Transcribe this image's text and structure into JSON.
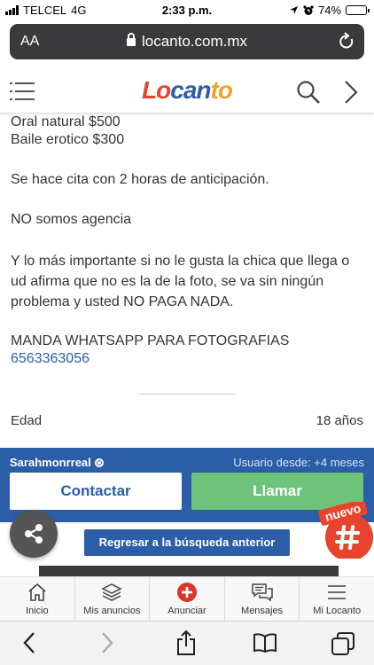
{
  "status_bar": {
    "carrier": "TELCEL",
    "network": "4G",
    "time": "2:33 p.m.",
    "battery": "74%",
    "battery_level": 0.74
  },
  "browser": {
    "text_size_label": "AA",
    "url": "locanto.com.mx"
  },
  "site": {
    "logo_part1": "Lo",
    "logo_part2": "can",
    "logo_part3": "to"
  },
  "listing": {
    "lines": [
      "Oral natural $500",
      "Baile erotico $300",
      "Se hace cita con 2 horas de anticipación.",
      "NO somos agencia",
      "Y lo más importante si no le gusta la chica que llega o ud afirma que no es la de la foto, se va sin ningún problema y usted NO PAGA NADA.",
      "MANDA WHATSAPP PARA FOTOGRAFIAS"
    ],
    "phone": "6563363056",
    "age_label": "Edad",
    "age_value": "18 años"
  },
  "seller": {
    "name": "Sarahmonrreal",
    "since": "Usuario desde: +4 meses",
    "contact_label": "Contactar",
    "call_label": "Llamar"
  },
  "back_label": "Regresar a la búsqueda anterior",
  "nuevo_label": "nuevo",
  "tabs": [
    {
      "label": "Inicio",
      "icon": "home-icon"
    },
    {
      "label": "Mis anuncios",
      "icon": "stack-icon"
    },
    {
      "label": "Anunciar",
      "icon": "plus-circle-icon"
    },
    {
      "label": "Mensajes",
      "icon": "chat-icon"
    },
    {
      "label": "Mi Locanto",
      "icon": "menu-icon"
    }
  ],
  "colors": {
    "brand_blue": "#2c5ea8",
    "call_green": "#6ec27a",
    "nuevo_red": "#e8432d"
  }
}
